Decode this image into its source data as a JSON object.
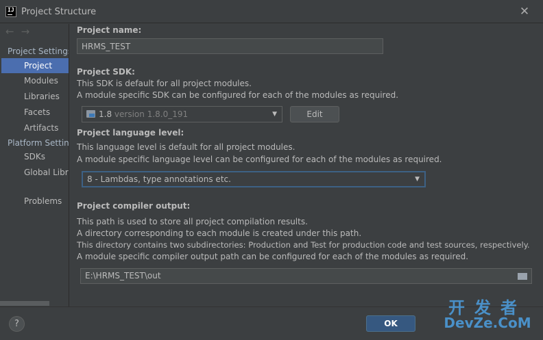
{
  "window": {
    "title": "Project Structure",
    "close_glyph": "✕"
  },
  "sidebar": {
    "back_glyph": "←",
    "forward_glyph": "→",
    "project_settings_header": "Project Settings",
    "project_settings_items": [
      {
        "label": "Project",
        "selected": true
      },
      {
        "label": "Modules"
      },
      {
        "label": "Libraries"
      },
      {
        "label": "Facets"
      },
      {
        "label": "Artifacts"
      }
    ],
    "platform_settings_header": "Platform Settings",
    "platform_settings_items": [
      {
        "label": "SDKs"
      },
      {
        "label": "Global Libraries"
      }
    ],
    "problems_label": "Problems"
  },
  "project_name": {
    "label": "Project name:",
    "value": "HRMS_TEST"
  },
  "project_sdk": {
    "label": "Project SDK:",
    "desc1": "This SDK is default for all project modules.",
    "desc2": "A module specific SDK can be configured for each of the modules as required.",
    "selected_name": "1.8",
    "selected_version": "version 1.8.0_191",
    "edit_label": "Edit"
  },
  "language_level": {
    "label": "Project language level:",
    "desc1": "This language level is default for all project modules.",
    "desc2": "A module specific language level can be configured for each of the modules as required.",
    "selected": "8 - Lambdas, type annotations etc."
  },
  "compiler_output": {
    "label": "Project compiler output:",
    "desc1": "This path is used to store all project compilation results.",
    "desc2": "A directory corresponding to each module is created under this path.",
    "desc3": "This directory contains two subdirectories: Production and Test for production code and test sources, respectively.",
    "desc4": "A module specific compiler output path can be configured for each of the modules as required.",
    "path": "E:\\HRMS_TEST\\out"
  },
  "footer": {
    "help_glyph": "?",
    "ok_label": "OK"
  },
  "watermark": {
    "cn": "开发者",
    "en": "DevZe.CoM"
  },
  "colors": {
    "selection": "#4b6eaf",
    "background": "#3c3f41",
    "primary_button": "#365880"
  }
}
